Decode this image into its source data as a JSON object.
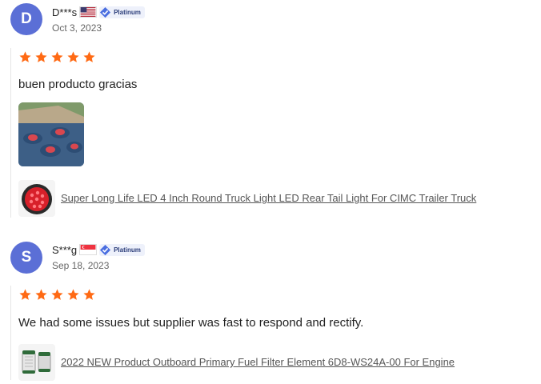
{
  "reviews": [
    {
      "avatar_letter": "D",
      "avatar_color": "#5b6fd6",
      "name": "D***s",
      "flag_icon": "us-flag-icon",
      "badge": "Platinum",
      "date": "Oct 3, 2023",
      "rating": 5,
      "text": "buen producto gracias",
      "product_link": "Super Long Life LED 4 Inch Round Truck Light LED Rear Tail Light For CIMC Trailer Truck"
    },
    {
      "avatar_letter": "S",
      "avatar_color": "#5b6fd6",
      "name": "S***g",
      "flag_icon": "sg-flag-icon",
      "badge": "Platinum",
      "date": "Sep 18, 2023",
      "rating": 5,
      "text": "We had some issues but supplier was fast to respond and rectify.",
      "product_link": "2022 NEW Product Outboard Primary Fuel Filter Element 6D8-WS24A-00 For Engine"
    }
  ],
  "colors": {
    "star": "#ff6a14",
    "avatar": "#5b6fd6",
    "badge_bg": "#eef1fb",
    "verified": "#4a6ee0"
  }
}
